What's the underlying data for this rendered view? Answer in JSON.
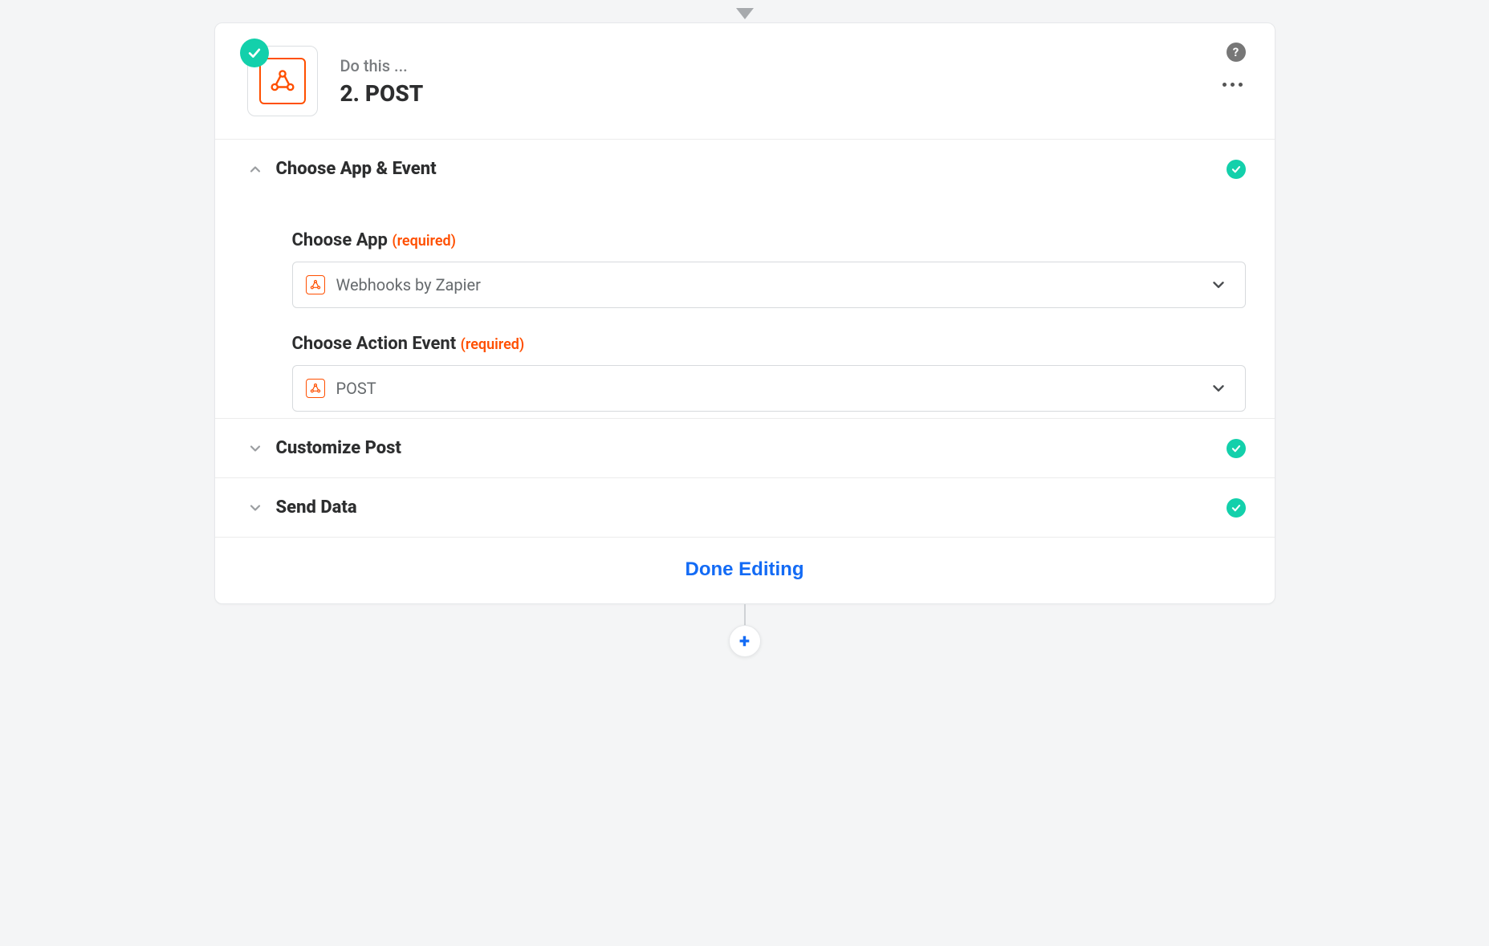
{
  "header": {
    "eyebrow": "Do this ...",
    "title": "2. POST",
    "icon_name": "webhook-icon",
    "completed": true
  },
  "sections": {
    "choose_app_event": {
      "title": "Choose App & Event",
      "expanded": true,
      "completed": true,
      "fields": {
        "choose_app": {
          "label": "Choose App",
          "required_text": "(required)",
          "value": "Webhooks by Zapier"
        },
        "choose_action_event": {
          "label": "Choose Action Event",
          "required_text": "(required)",
          "value": "POST"
        }
      }
    },
    "customize_post": {
      "title": "Customize Post",
      "expanded": false,
      "completed": true
    },
    "send_data": {
      "title": "Send Data",
      "expanded": false,
      "completed": true
    }
  },
  "footer": {
    "done_label": "Done Editing"
  },
  "add_step": {
    "label": "+"
  }
}
